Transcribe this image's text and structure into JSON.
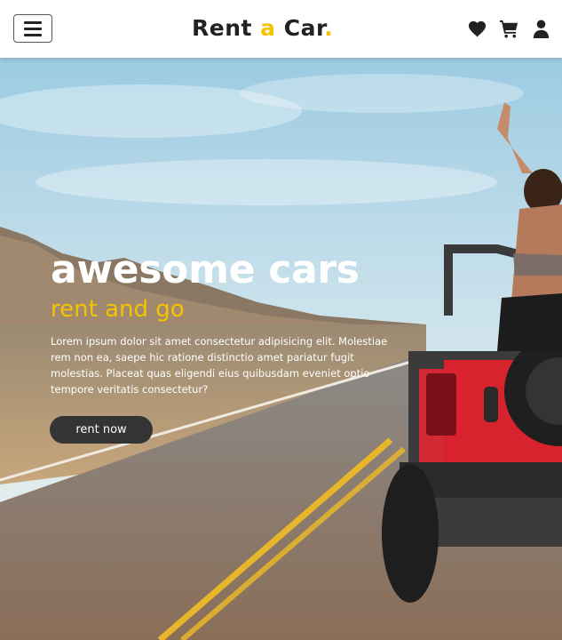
{
  "navbar": {
    "brand_pre": "Rent ",
    "brand_accent": "a",
    "brand_post": " Car",
    "brand_dot": ".",
    "icons": [
      "menu-icon",
      "heart-icon",
      "cart-icon",
      "user-icon"
    ]
  },
  "hero": {
    "title": "awesome cars",
    "subtitle": "rent and go",
    "text": "Lorem ipsum dolor sit amet consectetur adipisicing elit. Molestiae rem non ea, saepe hic ratione distinctio amet pariatur fugit molestias. Placeat quas eligendi eius quibusdam eveniet optio tempore veritatis consectetur?",
    "button_label": "rent now"
  },
  "colors": {
    "accent": "#f5c400",
    "button_bg": "#343434",
    "text_dark": "#222222"
  }
}
